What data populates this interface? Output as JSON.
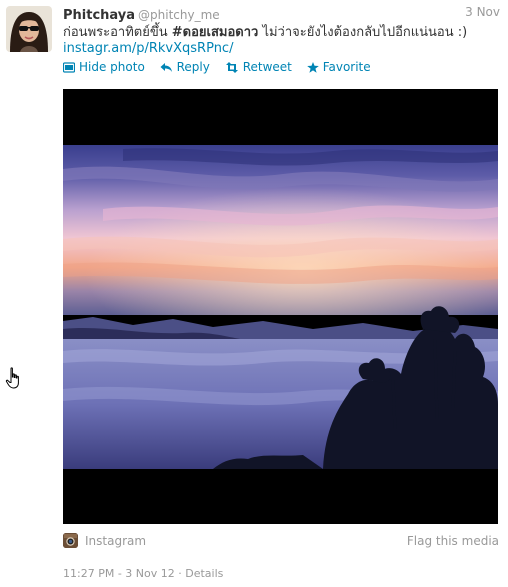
{
  "tweet": {
    "fullname": "Phitchaya",
    "username": "@phitchy_me",
    "date": "3 Nov",
    "text_part1": "ก่อนพระอาทิตย์ขึ้น ",
    "text_bold": "#ดอยเสมอดาว",
    "text_part2": " ไม่ว่าจะยังไงต้องกลับไปอีกแน่นอน :)",
    "link": "instagr.am/p/RkvXqsRPnc/"
  },
  "actions": {
    "hide_photo": "Hide photo",
    "reply": "Reply",
    "retweet": "Retweet",
    "favorite": "Favorite"
  },
  "media": {
    "source": "Instagram",
    "flag": "Flag this media"
  },
  "meta": {
    "timestamp": "11:27 PM - 3 Nov 12",
    "separator": " · ",
    "details": "Details"
  },
  "colors": {
    "link": "#0084b4",
    "muted": "#999999",
    "text": "#333333"
  },
  "icons": [
    "hide-photo-icon",
    "reply-icon",
    "retweet-icon",
    "favorite-icon",
    "instagram-icon",
    "hand-cursor-icon"
  ]
}
